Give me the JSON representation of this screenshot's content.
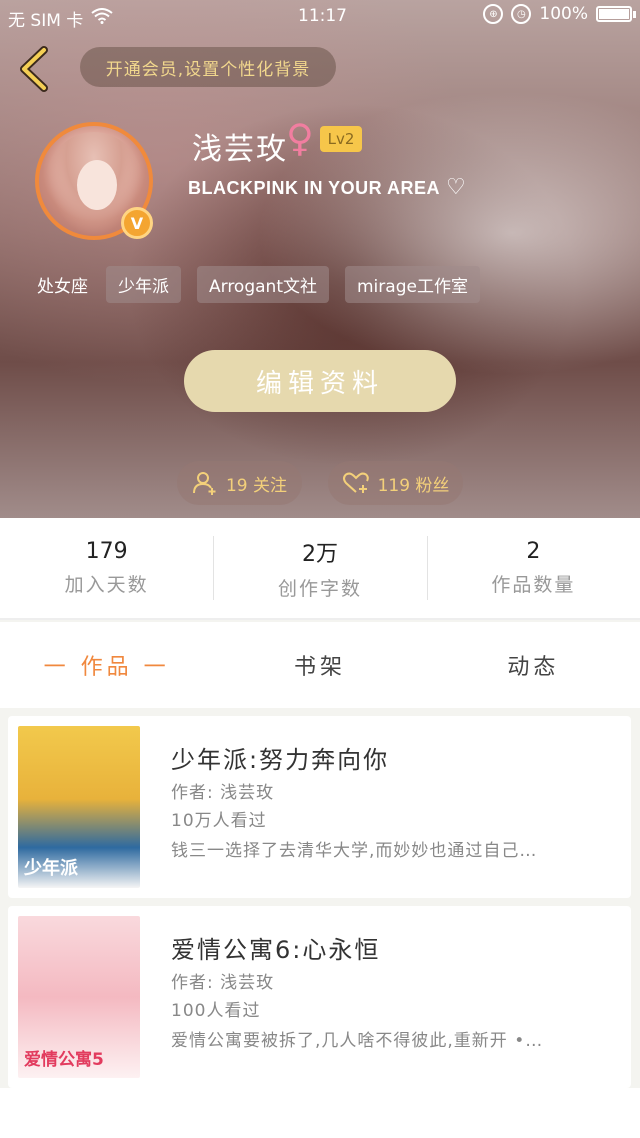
{
  "status_bar": {
    "carrier": "无 SIM 卡",
    "time": "11:17",
    "battery": "100%"
  },
  "header": {
    "vip_promo": "开通会员,设置个性化背景",
    "name": "浅芸玫",
    "gender_symbol": "♀",
    "level": "Lv2",
    "motto": "BLACKPINK IN YOUR AREA",
    "motto_heart": "♡",
    "zodiac": "处女座",
    "tags": [
      "少年派",
      "Arrogant文社",
      "mirage工作室"
    ],
    "edit_button": "编辑资料",
    "following": "19 关注",
    "followers": "119 粉丝"
  },
  "stats": [
    {
      "value": "179",
      "label": "加入天数"
    },
    {
      "value": "2万",
      "label": "创作字数"
    },
    {
      "value": "2",
      "label": "作品数量"
    }
  ],
  "tabs": [
    {
      "label": "一 作品 一",
      "active": true
    },
    {
      "label": "书架",
      "active": false
    },
    {
      "label": "动态",
      "active": false
    }
  ],
  "works": [
    {
      "title": "少年派:努力奔向你",
      "author": "作者: 浅芸玫",
      "views": "10万人看过",
      "description": "钱三一选择了去清华大学,而妙妙也通过自己…",
      "cover_text": "少年派"
    },
    {
      "title": "爱情公寓6:心永恒",
      "author": "作者: 浅芸玫",
      "views": "100人看过",
      "description": "爱情公寓要被拆了,几人啥不得彼此,重新开 •…",
      "cover_text": "爱情公寓5"
    }
  ],
  "colors": {
    "accent": "#f0883e",
    "gold": "#f3d07a",
    "edit_button_bg": "#e6d9ae"
  }
}
